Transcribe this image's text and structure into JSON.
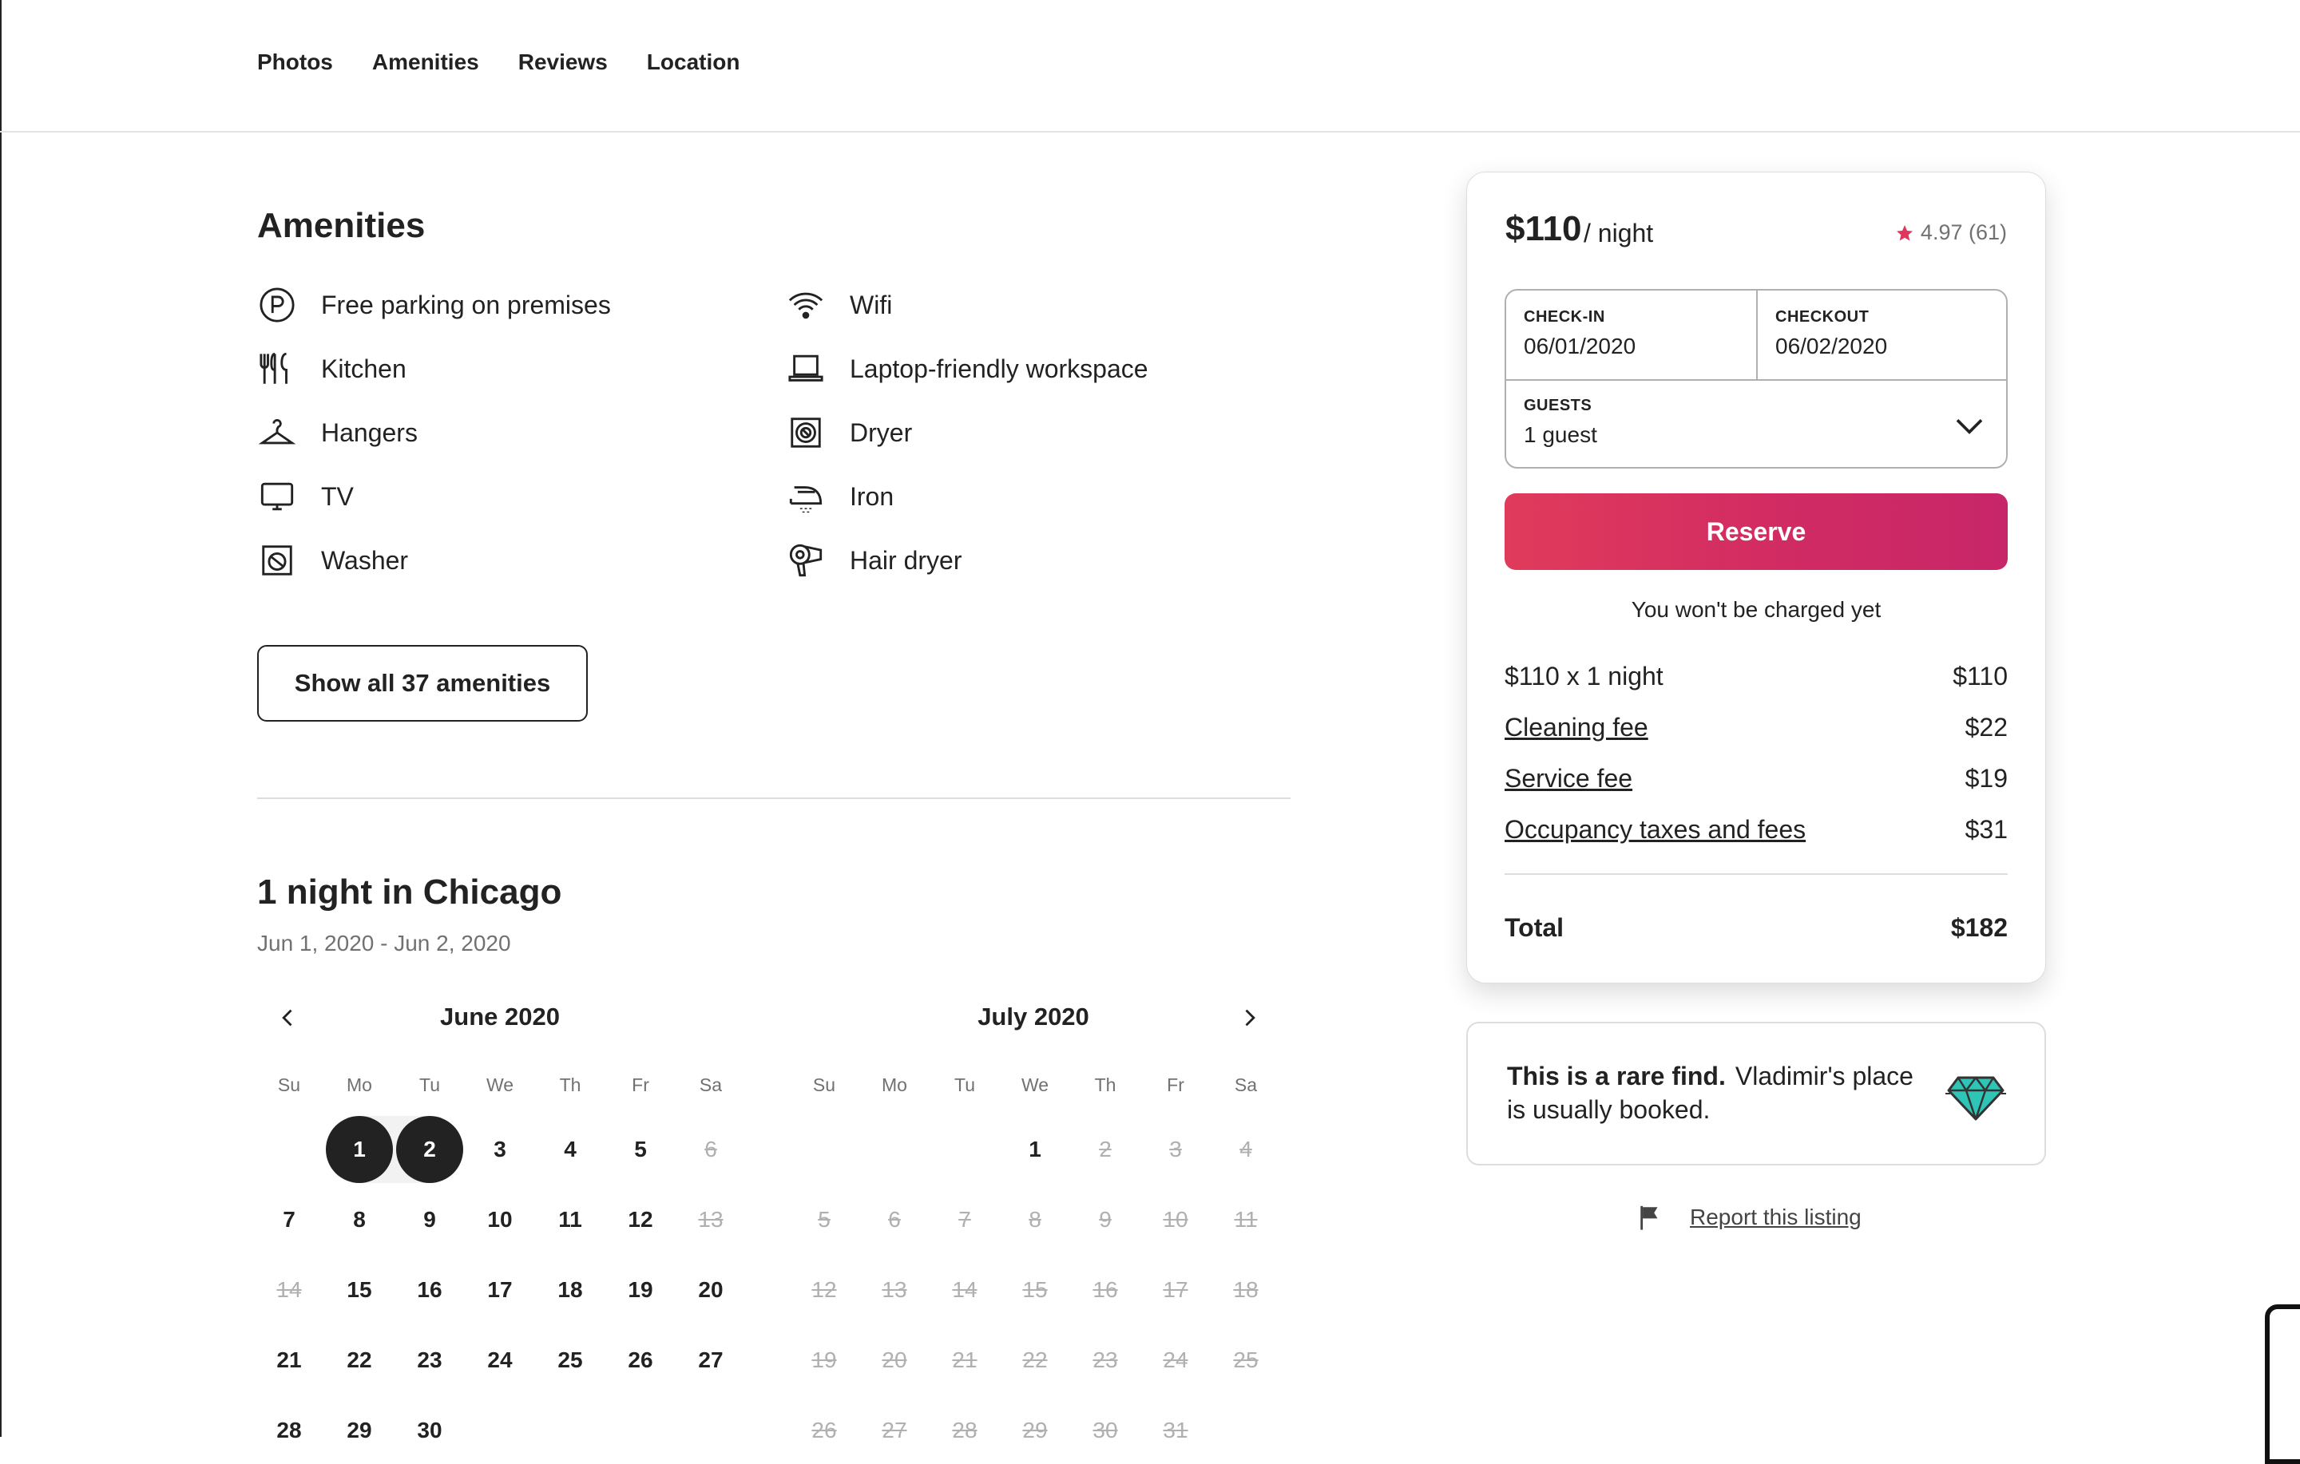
{
  "nav": {
    "items": [
      "Photos",
      "Amenities",
      "Reviews",
      "Location"
    ]
  },
  "amenities": {
    "title": "Amenities",
    "left": [
      {
        "label": "Free parking on premises",
        "icon": "parking-icon"
      },
      {
        "label": "Kitchen",
        "icon": "kitchen-icon"
      },
      {
        "label": "Hangers",
        "icon": "hanger-icon"
      },
      {
        "label": "TV",
        "icon": "tv-icon"
      },
      {
        "label": "Washer",
        "icon": "washer-icon"
      }
    ],
    "right": [
      {
        "label": "Wifi",
        "icon": "wifi-icon"
      },
      {
        "label": "Laptop-friendly workspace",
        "icon": "laptop-icon"
      },
      {
        "label": "Dryer",
        "icon": "dryer-icon"
      },
      {
        "label": "Iron",
        "icon": "iron-icon"
      },
      {
        "label": "Hair dryer",
        "icon": "hair-dryer-icon"
      }
    ],
    "show_all_label": "Show all 37 amenities"
  },
  "calendar": {
    "title": "1 night in Chicago",
    "subtitle": "Jun 1, 2020 - Jun 2, 2020",
    "weekdays": [
      "Su",
      "Mo",
      "Tu",
      "We",
      "Th",
      "Fr",
      "Sa"
    ],
    "months": [
      {
        "name": "June 2020",
        "first_weekday": 1,
        "days": 30,
        "blocked": [
          6,
          13,
          14
        ],
        "selected": [
          1,
          2
        ]
      },
      {
        "name": "July 2020",
        "first_weekday": 3,
        "days": 31,
        "blocked_from": 2,
        "selected": []
      }
    ]
  },
  "booking": {
    "price": "$110",
    "per_night": "/ night",
    "rating": "4.97 (61)",
    "checkin_label": "CHECK-IN",
    "checkin_value": "06/01/2020",
    "checkout_label": "CHECKOUT",
    "checkout_value": "06/02/2020",
    "guests_label": "GUESTS",
    "guests_value": "1 guest",
    "reserve_label": "Reserve",
    "no_charge_note": "You won't be charged yet",
    "fees": [
      {
        "label": "$110 x 1 night",
        "amount": "$110",
        "link": false
      },
      {
        "label": "Cleaning fee",
        "amount": "$22",
        "link": true
      },
      {
        "label": "Service fee",
        "amount": "$19",
        "link": true
      },
      {
        "label": "Occupancy taxes and fees",
        "amount": "$31",
        "link": true
      }
    ],
    "total_label": "Total",
    "total_amount": "$182",
    "accent_color": "#d92f5f"
  },
  "rare_find": {
    "bold": "This is a rare find.",
    "text": "Vladimir's place is usually booked."
  },
  "report_label": "Report this listing"
}
